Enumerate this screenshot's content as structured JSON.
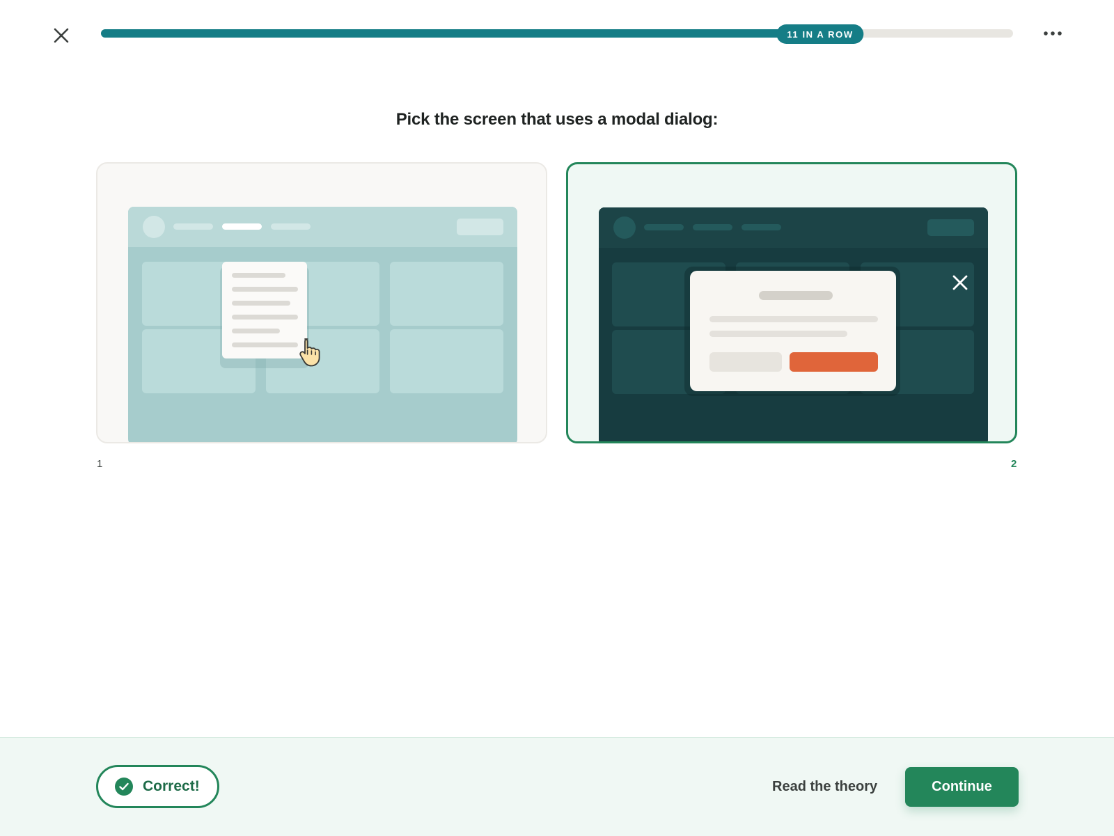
{
  "progress": {
    "fraction": 0.8,
    "streak_label": "11 IN A ROW"
  },
  "question": "Pick the screen that uses a modal dialog:",
  "options": [
    {
      "number": "1",
      "illustration": "popover-screen",
      "selected": false
    },
    {
      "number": "2",
      "illustration": "modal-dialog-screen",
      "selected": true
    }
  ],
  "feedback": {
    "status": "correct",
    "label": "Correct!"
  },
  "actions": {
    "read_theory_label": "Read the theory",
    "continue_label": "Continue"
  },
  "colors": {
    "accent_teal": "#157d86",
    "success_green": "#23865a",
    "modal_primary_button": "#e0653a"
  },
  "icons": {
    "close": "close-icon",
    "more": "more-icon",
    "check": "check-icon",
    "pointer": "pointer-hand-icon"
  }
}
